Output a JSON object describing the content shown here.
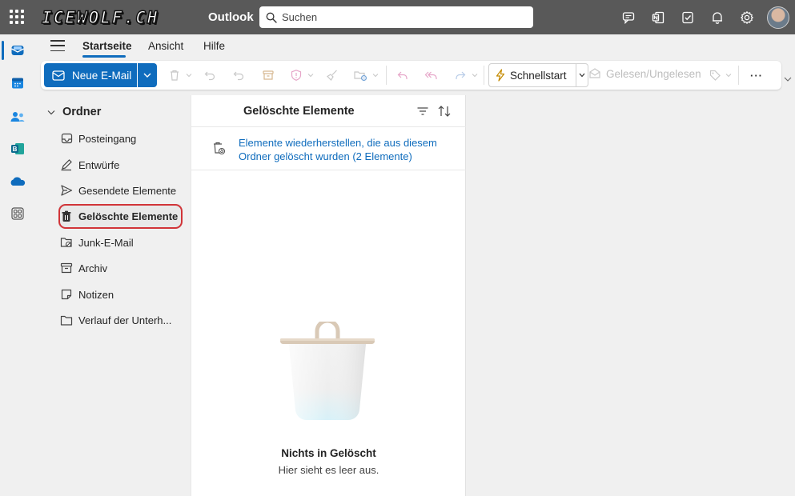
{
  "header": {
    "brand_text": "ICEWOLF.CH",
    "app_name": "Outlook",
    "search_placeholder": "Suchen"
  },
  "header_icons": [
    "teams-chat-icon",
    "onenote-icon",
    "todo-icon",
    "bell-icon",
    "gear-icon",
    "avatar"
  ],
  "rail": [
    "mail-icon",
    "calendar-icon",
    "people-icon",
    "bookings-icon",
    "onedrive-icon",
    "apps-icon"
  ],
  "tabs": [
    {
      "label": "Startseite",
      "active": true
    },
    {
      "label": "Ansicht",
      "active": false
    },
    {
      "label": "Hilfe",
      "active": false
    }
  ],
  "ribbon": {
    "new_mail": "Neue E-Mail",
    "quick_steps": "Schnellstart",
    "read_unread": "Gelesen/Ungelesen",
    "more": "···"
  },
  "folders": {
    "header": "Ordner",
    "items": [
      {
        "label": "Posteingang",
        "icon": "inbox-icon"
      },
      {
        "label": "Entwürfe",
        "icon": "drafts-icon"
      },
      {
        "label": "Gesendete Elemente",
        "icon": "send-icon"
      },
      {
        "label": "Gelöschte Elemente",
        "icon": "trash-icon",
        "selected": true
      },
      {
        "label": "Junk-E-Mail",
        "icon": "junk-icon"
      },
      {
        "label": "Archiv",
        "icon": "archive-icon"
      },
      {
        "label": "Notizen",
        "icon": "notes-icon"
      },
      {
        "label": "Verlauf der Unterh...",
        "icon": "folder-icon"
      }
    ]
  },
  "list": {
    "title": "Gelöschte Elemente",
    "recover_link": "Elemente wiederherstellen, die aus diesem Ordner gelöscht wurden (2 Elemente)",
    "empty_title": "Nichts in Gelöscht",
    "empty_subtitle": "Hier sieht es leer aus."
  },
  "colors": {
    "accent": "#0f6cbd",
    "header_bg": "#595959",
    "highlight": "#d13438"
  }
}
